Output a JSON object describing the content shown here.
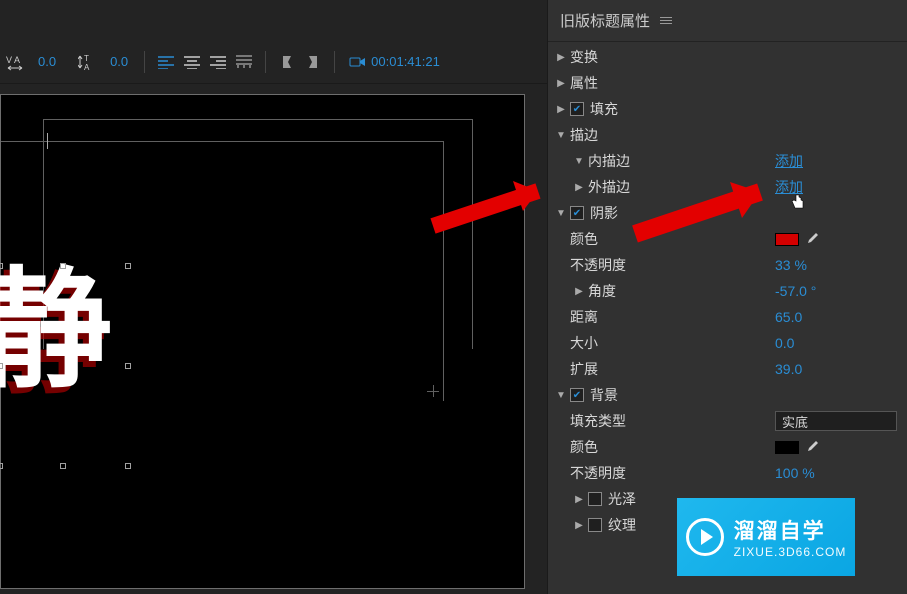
{
  "toolbar": {
    "kerning_value": "0.0",
    "leading_value": "0.0",
    "timecode": "00:01:41:21"
  },
  "canvas": {
    "text": "静"
  },
  "panel": {
    "title": "旧版标题属性",
    "sections": {
      "transform": "变换",
      "properties": "属性",
      "fill": "填充",
      "strokes": "描边",
      "inner_stroke": "内描边",
      "outer_stroke": "外描边",
      "add": "添加",
      "shadow": "阴影",
      "shadow_props": {
        "color": "颜色",
        "opacity": "不透明度",
        "opacity_val": "33 %",
        "angle": "角度",
        "angle_val": "-57.0 °",
        "distance": "距离",
        "distance_val": "65.0",
        "size": "大小",
        "size_val": "0.0",
        "spread": "扩展",
        "spread_val": "39.0"
      },
      "background": "背景",
      "bg_props": {
        "fill_type": "填充类型",
        "fill_type_val": "实底",
        "color": "颜色",
        "opacity": "不透明度",
        "opacity_val": "100 %"
      },
      "sheen": "光泽",
      "texture": "纹理"
    },
    "colors": {
      "shadow_swatch": "#d40000",
      "bg_swatch": "#000000"
    }
  },
  "watermark": {
    "name": "溜溜自学",
    "url": "ZIXUE.3D66.COM"
  }
}
